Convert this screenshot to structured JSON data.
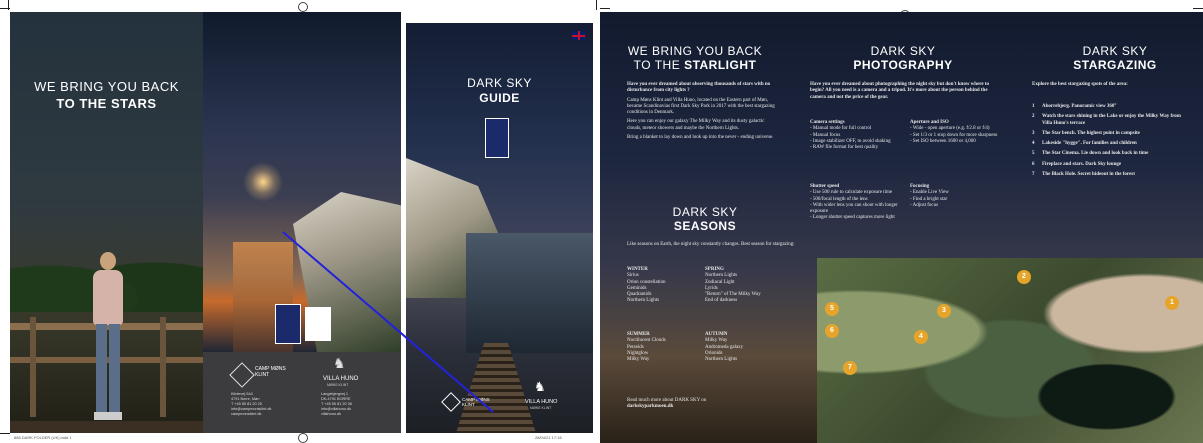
{
  "brochure_outer": {
    "cover_title_line1": "WE BRING YOU BACK",
    "cover_title_line2": "TO THE STARS",
    "camp_logo": "CAMP MØNS KLINT",
    "villa_logo": "VILLA HUNO",
    "villa_sub": "MØNS KLINT",
    "camp_address": [
      "Klintevej 544",
      "4791 Borre, Møn",
      "T +45 55 81 20 25",
      "info@campmonsklint.dk",
      "campmonsklint.dk"
    ],
    "villa_address": [
      "Langebjergvej 1",
      "DK-4791 BORRE",
      "T +45 55 81 20 36",
      "info@villahuno.dk",
      "villahuno.dk"
    ],
    "footer_left": "886 DARK FOLDER (UK).indd 1",
    "footer_right": "28/04/21 17:16"
  },
  "dark_sky_guide": {
    "title_line1": "DARK SKY",
    "title_line2": "GUIDE",
    "bottom_logo_left": "CAMP MØNS KLINT",
    "bottom_logo_right": "VILLA HUNO",
    "bottom_logo_right_sub": "MØNS KLINT",
    "flag": "uk-flag-icon"
  },
  "inner": {
    "starlight": {
      "title_line1": "WE BRING YOU BACK",
      "title_line2_prefix": "TO THE ",
      "title_line2_bold": "STARLIGHT",
      "lead": "Have you ever dreamed about observing thousands of stars with no disturbance from city lights ?",
      "p1": "Camp Møns Klint and Villa Huno, located on the Eastern part of Møn, became Scandinavias first Dark Sky Park in 2017 with the best stargazing conditions in Denmark.",
      "p2": "Here you can enjoy our galaxy The Milky Way and its dusty galactic clouds, meteor showers and maybe the Northern Lights.",
      "p3": "Bring a blanket to lay down and look up into the never - ending universe."
    },
    "seasons": {
      "title_line1": "DARK SKY",
      "title_line2": "SEASONS",
      "intro": "Like seasons on Earth, the night sky constantly changes. Best season for stargazing:",
      "winter_label": "WINTER",
      "winter": [
        "Sirius",
        "Orion constellation",
        "Geminids",
        "Quadrantids",
        "Northern Lights"
      ],
      "spring_label": "SPRING",
      "spring": [
        "Northern Lights",
        "Zodiacal Light",
        "Lyrids",
        "\"Return\" of The Milky Way",
        "End of darkness"
      ],
      "summer_label": "SUMMER",
      "summer": [
        "Noctilucent Clouds",
        "Perseids",
        "Nightglow",
        "Milky Way"
      ],
      "autumn_label": "AUTUMN",
      "autumn": [
        "Milky Way",
        "Andromeda galaxy",
        "Orionids",
        "Northern Lights"
      ],
      "more_line1": "Read much more about DARK SKY on",
      "more_line2": "darkskyparkmoen.dk"
    },
    "photography": {
      "title_line1": "DARK SKY",
      "title_line2": "PHOTOGRAPHY",
      "lead": "Have you ever dreamed about photographing the night sky but don't know where to begin? All you need is a camera and a tripod. It's more about the person behind the camera and not the price of the gear.",
      "camera_label": "Camera settings",
      "camera": [
        "Manual mode for full control",
        "Manual focus",
        "Image stabilizer OFF, to avoid shaking",
        "RAW file format for best quality"
      ],
      "aperture_label": "Aperture and ISO",
      "aperture": [
        "Wide - open aperture (e.g. f/2.8 or f/4)",
        "Set 1/3 or 1 stop down for more sharpness",
        "Set ISO between 1600 or 4,000"
      ],
      "shutter_label": "Shutter speed",
      "shutter": [
        "Use 500 rule to calculate exposure time",
        "500/focal length of the lens",
        "With wider lens you can shoot with longer exposure",
        "Longer shutter speed captures more light"
      ],
      "focusing_label": "Focusing",
      "focusing": [
        "Enable Live View",
        "Find a bright star",
        "Adjust focus"
      ]
    },
    "stargazing": {
      "title_line1": "DARK SKY",
      "title_line2": "STARGAZING",
      "intro": "Explore the best stargazing spots of the area:",
      "spots": [
        {
          "num": "1",
          "text": "Aborrebjerg. Panoramic view 360°"
        },
        {
          "num": "2",
          "text": "Watch the stars shining in the Lake or enjoy the Milky Way from Villa Huno's terrace"
        },
        {
          "num": "3",
          "text": "The Star bench. The highest point in campsite"
        },
        {
          "num": "4",
          "text": "Lakeside \"hygge\". For families and children"
        },
        {
          "num": "5",
          "text": "The Star Cinema. Lie down and look back in time"
        },
        {
          "num": "6",
          "text": "Fireplace and stars. Dark Sky lounge"
        },
        {
          "num": "7",
          "text": "The Black Hole. Secret hideout in the forest"
        }
      ],
      "map_markers": [
        "1",
        "2",
        "3",
        "4",
        "5",
        "6",
        "7"
      ]
    }
  },
  "colors": {
    "night_sky": "#0d1325",
    "panel_gray": "#3c3c3f",
    "marker_gold": "#e6a52a",
    "annotation_line": "#2222dd"
  }
}
